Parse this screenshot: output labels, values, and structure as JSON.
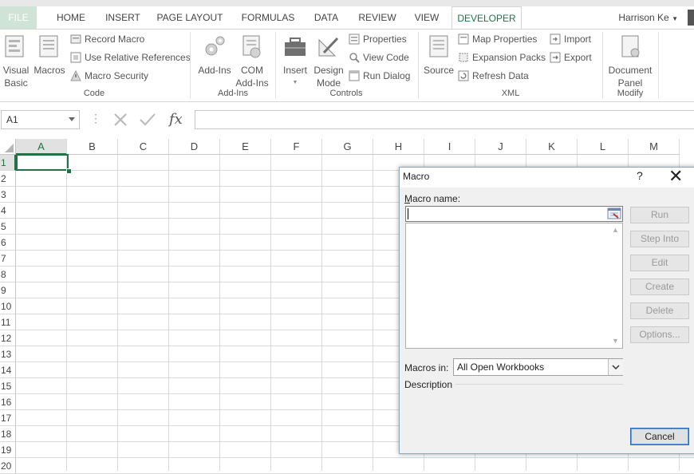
{
  "tabs": [
    "FILE",
    "HOME",
    "INSERT",
    "PAGE LAYOUT",
    "FORMULAS",
    "DATA",
    "REVIEW",
    "VIEW",
    "DEVELOPER"
  ],
  "user_name": "Harrison Ke",
  "ribbon": {
    "code": {
      "visual_basic": "Visual\nBasic",
      "macros": "Macros",
      "record_macro": "Record Macro",
      "use_relative": "Use Relative References",
      "macro_security": "Macro Security",
      "label": "Code"
    },
    "addins": {
      "addins": "Add-Ins",
      "com_addins": "COM\nAdd-Ins",
      "label": "Add-Ins"
    },
    "controls": {
      "insert": "Insert",
      "design_mode": "Design\nMode",
      "properties": "Properties",
      "view_code": "View Code",
      "run_dialog": "Run Dialog",
      "label": "Controls"
    },
    "xml": {
      "source": "Source",
      "map_properties": "Map Properties",
      "expansion_packs": "Expansion Packs",
      "refresh_data": "Refresh Data",
      "import": "Import",
      "export": "Export",
      "label": "XML"
    },
    "modify": {
      "document_panel": "Document\nPanel",
      "label": "Modify"
    }
  },
  "formula_bar": {
    "name_box": "A1",
    "fx": "fx",
    "value": ""
  },
  "grid": {
    "columns": [
      "A",
      "B",
      "C",
      "D",
      "E",
      "F",
      "G",
      "H",
      "I",
      "J",
      "K",
      "L",
      "M"
    ],
    "rows": [
      "1",
      "2",
      "3",
      "4",
      "5",
      "6",
      "7",
      "8",
      "9",
      "10",
      "11",
      "12",
      "13",
      "14",
      "15",
      "16",
      "17",
      "18",
      "19",
      "20"
    ],
    "active_cell": "A1"
  },
  "dialog": {
    "title": "Macro",
    "help": "?",
    "close": "✕",
    "macro_name_label": "Macro name:",
    "macro_name_value": "",
    "buttons": {
      "run": "Run",
      "step_into": "Step Into",
      "edit": "Edit",
      "create": "Create",
      "delete": "Delete",
      "options": "Options..."
    },
    "macros_in_label": "Macros in:",
    "macros_in_value": "All Open Workbooks",
    "description_label": "Description",
    "cancel": "Cancel"
  },
  "colors": {
    "excel_green": "#217346",
    "button_disabled_text": "#9a9a9a",
    "focus_blue": "#2b6cbb"
  }
}
